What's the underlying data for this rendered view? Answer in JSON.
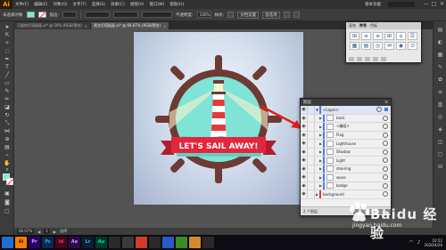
{
  "app": {
    "logo": "Ai",
    "menus": [
      "文件(F)",
      "编辑(E)",
      "对象(O)",
      "文字(T)",
      "选择(S)",
      "效果(C)",
      "视图(V)",
      "窗口(W)",
      "帮助(H)"
    ],
    "workspace": "基本功能",
    "window_buttons": [
      "—",
      "□",
      "✕"
    ]
  },
  "control_bar": {
    "selection_label": "未选择对象",
    "stroke_label": "描边:",
    "opacity_label": "不透明度:",
    "opacity_value": "100%",
    "style_label": "样式:",
    "doc_setup": "文档设置",
    "prefs": "首选项"
  },
  "tabs": [
    {
      "label": "可爱的灯塔插画.ai* @ 50% (RGB/预览)",
      "active": false
    },
    {
      "label": "原文灯塔插画.ai* @ 66.67% (RGB/预览)",
      "active": true
    }
  ],
  "artwork": {
    "banner_text": "LET'S SAIL AWAY!",
    "colors": {
      "wheel": "#6e3a35",
      "sea": "#7fe3d6",
      "banner": "#e3263d",
      "tower_red": "#e33a3a",
      "light": "#f7f3c8"
    }
  },
  "symbols_panel": {
    "tabs": [
      "画笔",
      "符号",
      "色板"
    ],
    "active_tab": "符号",
    "icons": [
      "⊞",
      "≡",
      "≡",
      "⊞",
      "⌂",
      "☰",
      "▦",
      "▤",
      "◎",
      "✉",
      "◉",
      "⊙"
    ]
  },
  "layers_panel": {
    "title": "图层",
    "rows": [
      {
        "name": "<Layer>",
        "level": 0,
        "expanded": true
      },
      {
        "name": "back",
        "level": 1
      },
      {
        "name": "<编组>",
        "level": 1
      },
      {
        "name": "Flag",
        "level": 1
      },
      {
        "name": "Lighthouse",
        "level": 1
      },
      {
        "name": "Shadow",
        "level": 1
      },
      {
        "name": "Light",
        "level": 1
      },
      {
        "name": "steering",
        "level": 1
      },
      {
        "name": "wave",
        "level": 1
      },
      {
        "name": "badge",
        "level": 1
      },
      {
        "name": "background",
        "level": 0
      }
    ],
    "footer_text": "2 个图层"
  },
  "status_bar": {
    "zoom": "66.67%",
    "page": "1",
    "tool_name": "选择"
  },
  "taskbar": {
    "apps": [
      {
        "label": "",
        "color": "#1f6fd1"
      },
      {
        "label": "Ai",
        "color": "#ff7c00"
      },
      {
        "label": "Pr",
        "color": "#2a0066"
      },
      {
        "label": "Ps",
        "color": "#0a2a4a"
      },
      {
        "label": "Id",
        "color": "#49021f"
      },
      {
        "label": "Ae",
        "color": "#2a0a4a"
      },
      {
        "label": "Lr",
        "color": "#0a1f2f"
      },
      {
        "label": "Au",
        "color": "#003a2a"
      },
      {
        "label": "",
        "color": "#2a2a2a"
      },
      {
        "label": "",
        "color": "#3a3a3a"
      },
      {
        "label": "",
        "color": "#d43a2a"
      },
      {
        "label": "",
        "color": "#2a2a2a"
      },
      {
        "label": "",
        "color": "#2a5ac8"
      },
      {
        "label": "",
        "color": "#3a8a2a"
      },
      {
        "label": "",
        "color": "#d48a2a"
      },
      {
        "label": "",
        "color": "#2a2a2a"
      }
    ],
    "time": "10:52",
    "date": "2020/4/26"
  },
  "watermark": {
    "brand": "Baidu 经验",
    "url": "jingyan.baidu.com"
  }
}
